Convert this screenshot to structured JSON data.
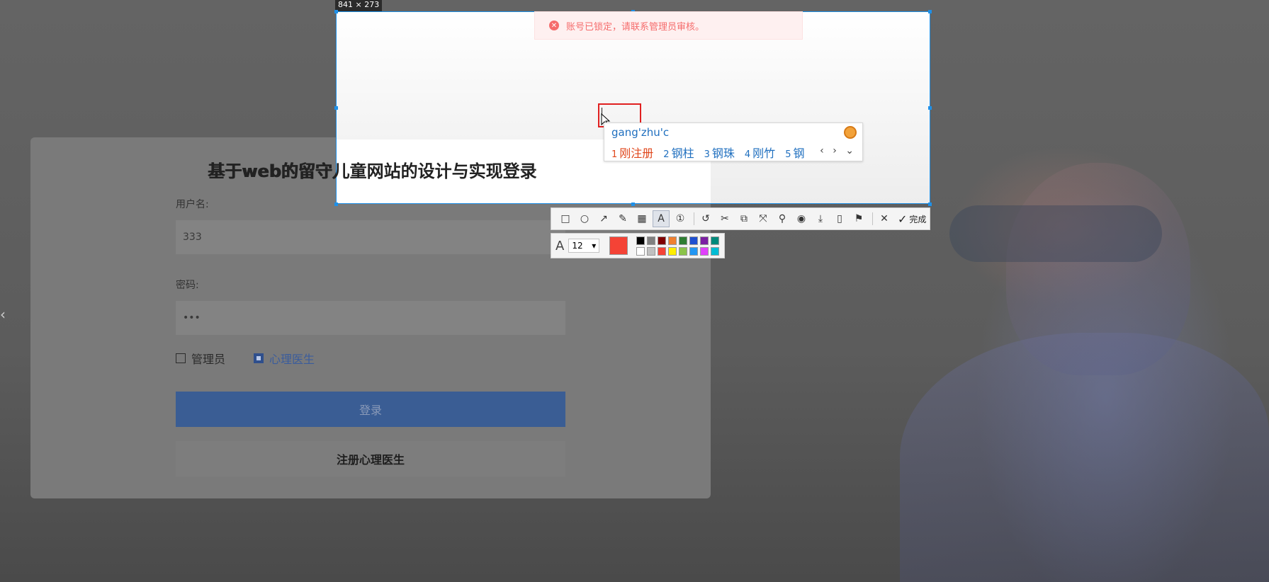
{
  "login": {
    "title": "基于web的留守儿童网站的设计与实现登录",
    "username_label": "用户名:",
    "username_value": "333",
    "password_label": "密码:",
    "password_value": "•••",
    "role_admin": "管理员",
    "role_doctor": "心理医生",
    "login_button": "登录",
    "register_button": "注册心理医生"
  },
  "alert": {
    "message": "账号已锁定，请联系管理员审核。",
    "icon": "close-circle-icon"
  },
  "capture": {
    "size_label": "841 × 273"
  },
  "ime": {
    "input": "gang'zhu'c",
    "candidates": [
      {
        "num": "1",
        "text": "刚注册"
      },
      {
        "num": "2",
        "text": "钢柱"
      },
      {
        "num": "3",
        "text": "钢珠"
      },
      {
        "num": "4",
        "text": "刚竹"
      },
      {
        "num": "5",
        "text": "钢"
      }
    ],
    "nav": "‹ › ⌄"
  },
  "toolbar": {
    "done_label": "完成",
    "tools": [
      "rectangle-icon",
      "ellipse-icon",
      "arrow-icon",
      "pencil-icon",
      "mosaic-icon",
      "text-icon",
      "number-icon",
      "undo-icon",
      "cut-icon",
      "copy-icon",
      "transform-icon",
      "pin-icon",
      "record-icon",
      "download-icon",
      "phone-icon",
      "bookmark-icon",
      "close-icon"
    ]
  },
  "subbar": {
    "font_size": "12",
    "current_color": "#f44336",
    "palette": [
      "#000000",
      "#808080",
      "#800000",
      "#f08030",
      "#2e7d32",
      "#1e4fd0",
      "#7b1fa2",
      "#00897b",
      "#ffffff",
      "#c0c0c0",
      "#f44336",
      "#ffee00",
      "#8bc34a",
      "#2196f3",
      "#e040fb",
      "#00bcd4"
    ]
  },
  "colors": {
    "accent": "#1e90e8",
    "error": "#f56c6c",
    "primary_button": "#3a5d94"
  }
}
